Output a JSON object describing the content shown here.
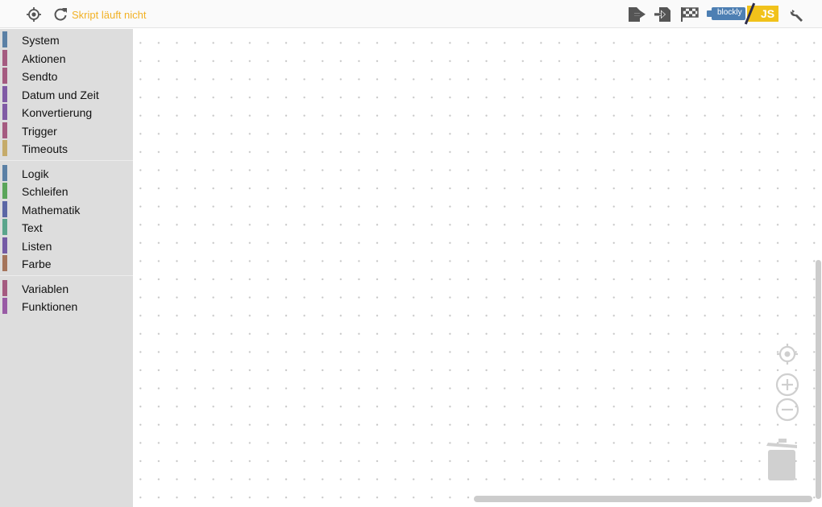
{
  "toolbar": {
    "status_text": "Skript läuft nicht",
    "status_color": "#f2b124",
    "icons": [
      "target-icon",
      "refresh-icon",
      "export-icon",
      "import-icon",
      "checkered-flag-icon",
      "blockly-js-toggle",
      "wrench-icon"
    ],
    "toggle": {
      "blockly_label": "blockly",
      "js_label": "JS"
    }
  },
  "toolbox": {
    "groups": [
      [
        {
          "label": "System",
          "color": "#5b80a5"
        },
        {
          "label": "Aktionen",
          "color": "#a55b80"
        },
        {
          "label": "Sendto",
          "color": "#a55b80"
        },
        {
          "label": "Datum und Zeit",
          "color": "#805ba5"
        },
        {
          "label": "Konvertierung",
          "color": "#805ba5"
        },
        {
          "label": "Trigger",
          "color": "#a55b80"
        },
        {
          "label": "Timeouts",
          "color": "#c5ab6a"
        }
      ],
      [
        {
          "label": "Logik",
          "color": "#5b80a5"
        },
        {
          "label": "Schleifen",
          "color": "#5ba55b"
        },
        {
          "label": "Mathematik",
          "color": "#5b67a5"
        },
        {
          "label": "Text",
          "color": "#5ba58c"
        },
        {
          "label": "Listen",
          "color": "#745ba5"
        },
        {
          "label": "Farbe",
          "color": "#a5745b"
        }
      ],
      [
        {
          "label": "Variablen",
          "color": "#a55b80"
        },
        {
          "label": "Funktionen",
          "color": "#995ba5"
        }
      ]
    ]
  },
  "workspace": {
    "controls": [
      "recenter-icon",
      "zoom-in-icon",
      "zoom-out-icon",
      "trash-icon"
    ]
  }
}
